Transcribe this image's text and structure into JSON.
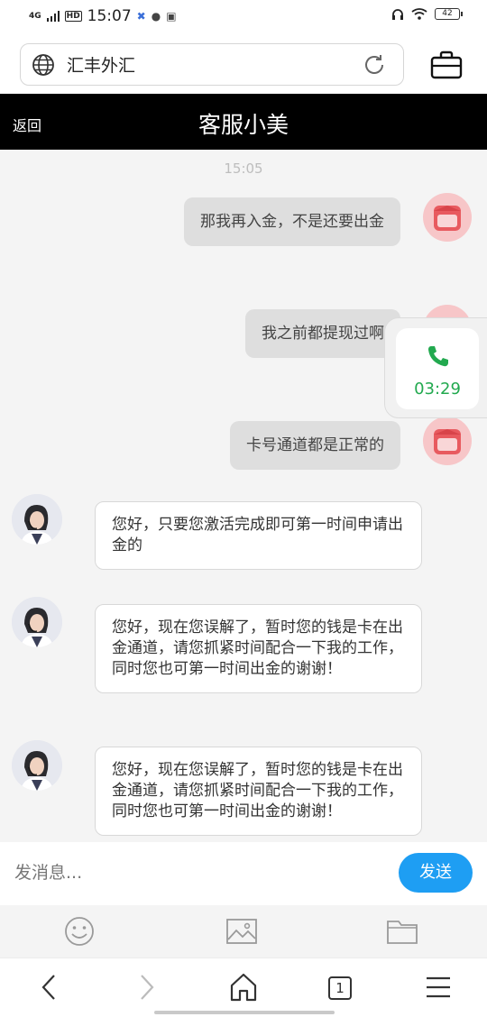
{
  "status_bar": {
    "network": "4G",
    "hd": "HD",
    "time": "15:07",
    "battery": "42"
  },
  "url_bar": {
    "url_text": "汇丰外汇"
  },
  "chat_header": {
    "back_label": "返回",
    "title": "客服小美"
  },
  "chat": {
    "timestamp": "15:05",
    "messages_out": [
      {
        "text": "那我再入金，不是还要出金"
      },
      {
        "text": "我之前都提现过啊"
      },
      {
        "text": "卡号通道都是正常的"
      }
    ],
    "messages_in": [
      {
        "text": "您好，只要您激活完成即可第一时间申请出金的"
      },
      {
        "text": "您好，现在您误解了，暂时您的钱是卡在出金通道，请您抓紧时间配合一下我的工作，同时您也可第一时间出金的谢谢！"
      },
      {
        "text": "您好，现在您误解了，暂时您的钱是卡在出金通道，请您抓紧时间配合一下我的工作，同时您也可第一时间出金的谢谢！"
      }
    ]
  },
  "call_widget": {
    "timer": "03:29",
    "accent_color": "#22a94f"
  },
  "composer": {
    "placeholder": "发消息...",
    "send_label": "发送",
    "send_color": "#1e9ef3"
  },
  "tools": [
    "emoji-icon",
    "image-icon",
    "folder-icon"
  ],
  "browser_nav": {
    "tab_count": "1"
  }
}
